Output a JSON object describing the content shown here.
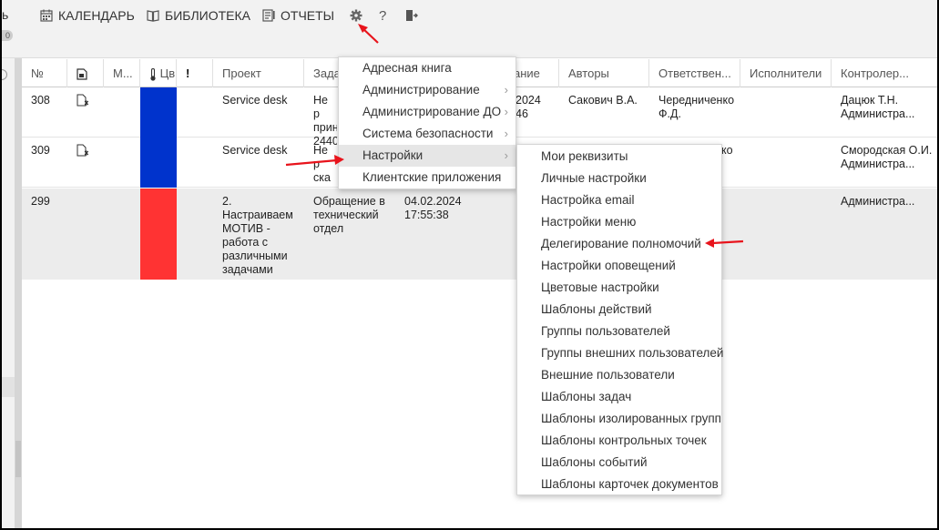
{
  "topbar": {
    "cut_left_label": "ь",
    "cut_badge": "0",
    "nav": [
      {
        "label": "КАЛЕНДАРЬ",
        "icon": "calendar-icon"
      },
      {
        "label": "БИБЛИОТЕКА",
        "icon": "book-icon"
      },
      {
        "label": "ОТЧЕТЫ",
        "icon": "report-icon"
      }
    ],
    "help_label": "?",
    "icons": {
      "settings": "gear-icon",
      "help": "question-icon",
      "logout": "logout-icon"
    }
  },
  "table": {
    "headers": [
      "№",
      "",
      "М...",
      "Цв",
      "!",
      "Проект",
      "Зада",
      "",
      "ание",
      "Авторы",
      "Ответствен...",
      "Исполнители",
      "Контролер..."
    ],
    "rows": [
      {
        "num": "308",
        "project": "Service desk",
        "task": "Не р прин 2440",
        "date": "2024 46",
        "authors": "Сакович В.А.",
        "responsible": "Чередниченко Ф.Д.",
        "controller": "Дацюк Т.Н. Администра...",
        "color": "#0033cc"
      },
      {
        "num": "309",
        "project": "Service desk",
        "task": "Не р ска",
        "date": "",
        "authors": "",
        "responsible": "ко",
        "controller": "Смородская О.И. Администра...",
        "color": "#0033cc"
      },
      {
        "num": "299",
        "project": "2. Настраиваем МОТИВ - работа с различными задачами",
        "task": "Обращение в технический отдел",
        "date": "04.02.2024 17:55:38",
        "authors": "",
        "responsible": "",
        "controller": "Администра...",
        "color": "#ff3333"
      }
    ]
  },
  "menu": {
    "items": [
      {
        "label": "Адресная книга",
        "submenu": false
      },
      {
        "label": "Администрирование",
        "submenu": true
      },
      {
        "label": "Администрирование ДО",
        "submenu": true
      },
      {
        "label": "Система безопасности",
        "submenu": true
      },
      {
        "label": "Настройки",
        "submenu": true,
        "active": true
      },
      {
        "label": "Клиентские приложения",
        "submenu": false
      }
    ],
    "chevron": "›"
  },
  "submenu": {
    "items": [
      "Мои реквизиты",
      "Личные настройки",
      "Настройка email",
      "Настройки меню",
      "Делегирование полномочий",
      "Настройки оповещений",
      "Цветовые настройки",
      "Шаблоны действий",
      "Группы пользователей",
      "Группы внешних пользователей",
      "Внешние пользователи",
      "Шаблоны задач",
      "Шаблоны изолированных групп",
      "Шаблоны контрольных точек",
      "Шаблоны событий",
      "Шаблоны карточек документов"
    ]
  },
  "colors": {
    "arrow": "#e8141c",
    "blue_bar": "#0033cc",
    "red_bar": "#ff3333"
  }
}
